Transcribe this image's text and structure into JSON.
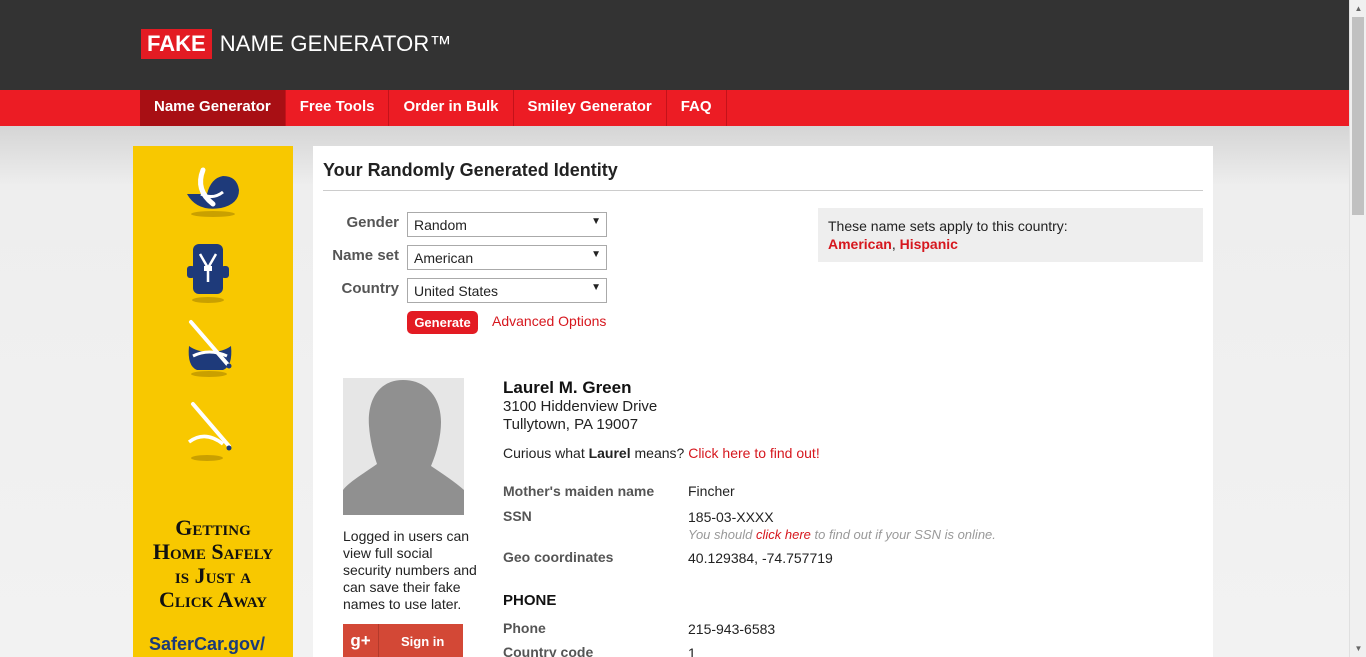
{
  "header": {
    "logo_fake": "FAKE",
    "logo_rest": "NAME GENERATOR™"
  },
  "nav": {
    "items": [
      {
        "label": "Name Generator",
        "active": true
      },
      {
        "label": "Free Tools"
      },
      {
        "label": "Order in Bulk"
      },
      {
        "label": "Smiley Generator"
      },
      {
        "label": "FAQ"
      }
    ]
  },
  "ad": {
    "headline_1": "Getting",
    "headline_2": "Home Safely",
    "headline_3": "is Just a",
    "headline_4": "Click Away",
    "url": "SaferCar.gov/",
    "icons": [
      "infant-seat-icon",
      "harness-seat-icon",
      "booster-seat-icon",
      "seat-belt-icon"
    ]
  },
  "main": {
    "title": "Your Randomly Generated Identity",
    "form": {
      "gender_label": "Gender",
      "gender_value": "Random",
      "nameset_label": "Name set",
      "nameset_value": "American",
      "country_label": "Country",
      "country_value": "United States",
      "generate_label": "Generate",
      "advanced_label": "Advanced Options"
    },
    "country_box": {
      "text": "These name sets apply to this country:",
      "link_1": "American",
      "separator": ",",
      "link_2": "Hispanic"
    },
    "login_note": "Logged in users can view full social security numbers and can save their fake names to use later.",
    "gplus": {
      "glyph": "g+",
      "label": "Sign in"
    },
    "identity": {
      "name": "Laurel M. Green",
      "street": "3100 Hiddenview Drive",
      "city": "Tullytown, PA 19007",
      "curious_prefix": "Curious what",
      "curious_name": "Laurel",
      "curious_suffix": "means?",
      "curious_link": "Click here to find out!",
      "maiden_label": "Mother's maiden name",
      "maiden_value": "Fincher",
      "ssn_label": "SSN",
      "ssn_value": "185-03-XXXX",
      "ssn_hint_prefix": "You should",
      "ssn_hint_link": "click here",
      "ssn_hint_suffix": "to find out if your SSN is online.",
      "geo_label": "Geo coordinates",
      "geo_value": "40.129384, -74.757719",
      "phone_section": "PHONE",
      "phone_label": "Phone",
      "phone_value": "215-943-6583",
      "country_code_label": "Country code",
      "country_code_value": "1"
    }
  },
  "colors": {
    "brand_red": "#ec1c24",
    "header_dark": "#333333",
    "ad_yellow": "#f8c800"
  }
}
